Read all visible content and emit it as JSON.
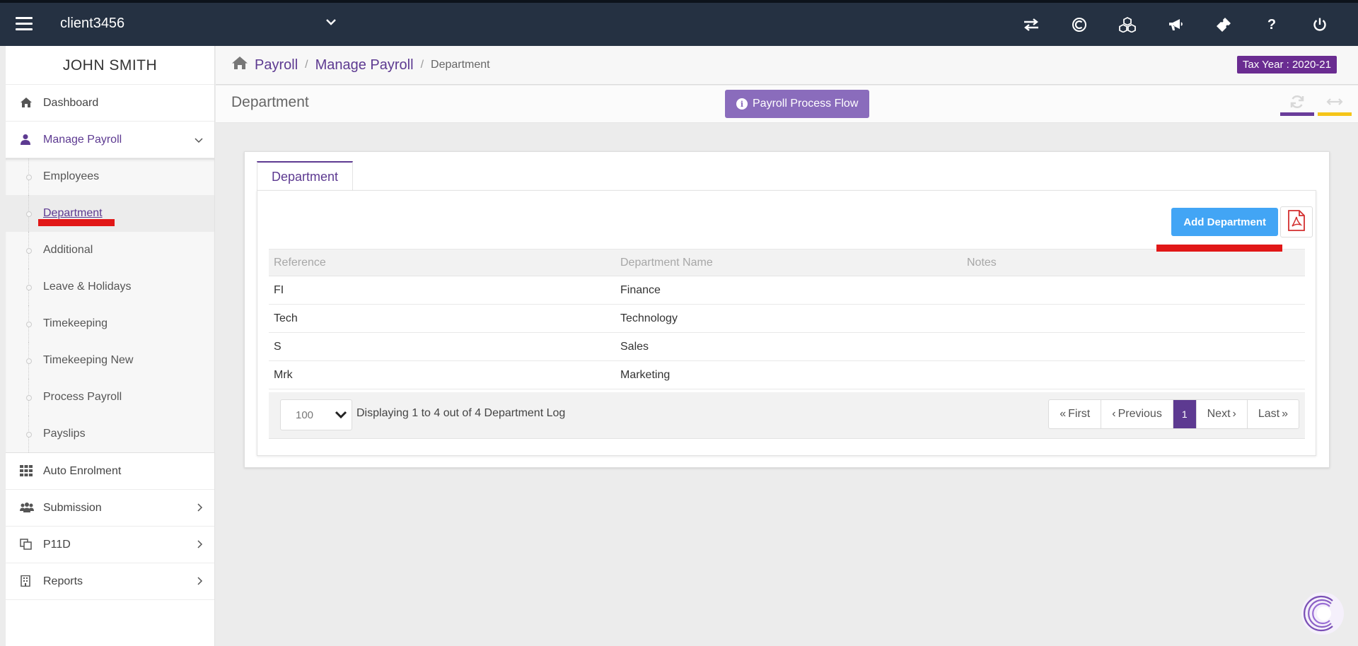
{
  "topbar": {
    "client_name": "client3456",
    "icons": [
      "switch-icon",
      "copyright-icon",
      "cubes-icon",
      "bullhorn-icon",
      "ticket-icon",
      "help-icon",
      "power-icon"
    ]
  },
  "sidebar": {
    "user_name": "JOHN SMITH",
    "items": [
      {
        "label": "Dashboard"
      },
      {
        "label": "Manage Payroll"
      },
      {
        "label": "Auto Enrolment"
      },
      {
        "label": "Submission"
      },
      {
        "label": "P11D"
      },
      {
        "label": "Reports"
      }
    ],
    "submenu": [
      {
        "label": "Employees"
      },
      {
        "label": "Department"
      },
      {
        "label": "Additional"
      },
      {
        "label": "Leave & Holidays"
      },
      {
        "label": "Timekeeping"
      },
      {
        "label": "Timekeeping New"
      },
      {
        "label": "Process Payroll"
      },
      {
        "label": "Payslips"
      }
    ]
  },
  "breadcrumb": {
    "items": [
      "Payroll",
      "Manage Payroll",
      "Department"
    ],
    "separator": "/"
  },
  "tax_year": "Tax Year : 2020-21",
  "page": {
    "title": "Department",
    "flow_button": "Payroll Process Flow"
  },
  "panel": {
    "tab": "Department",
    "add_button": "Add Department",
    "table": {
      "headers": [
        "Reference",
        "Department Name",
        "Notes"
      ],
      "rows": [
        [
          "FI",
          "Finance",
          ""
        ],
        [
          "Tech",
          "Technology",
          ""
        ],
        [
          "S",
          "Sales",
          ""
        ],
        [
          "Mrk",
          "Marketing",
          ""
        ]
      ]
    },
    "per_page": "100",
    "display_text": "Displaying 1 to 4 out of 4 Department Log",
    "pagination": {
      "first": "First",
      "previous": "Previous",
      "current": "1",
      "next": "Next",
      "last": "Last"
    }
  },
  "colors": {
    "topbar": "#253142",
    "accent_purple": "#5d3a91",
    "tax_badge": "#6a2c91",
    "flow_button": "#8a6cbc",
    "add_button": "#42a5f5",
    "annotation_red": "#e11717",
    "header_bar_purple": "#6a3d9a",
    "header_bar_yellow": "#f5c518"
  }
}
